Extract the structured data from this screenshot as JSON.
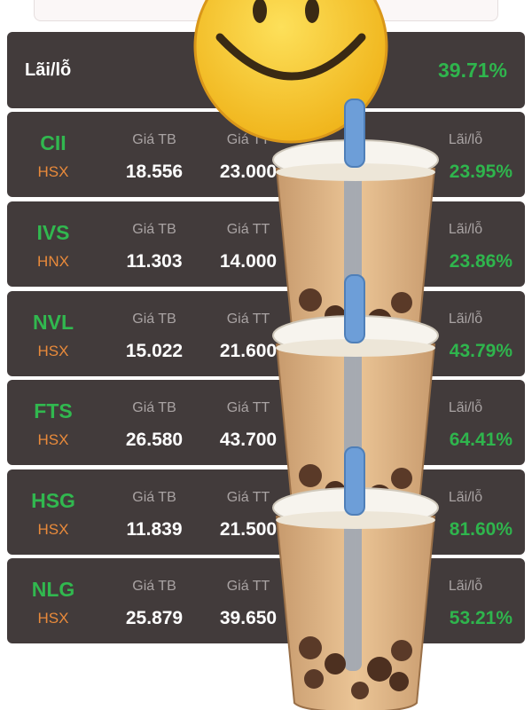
{
  "summary": {
    "label": "Lãi/lỗ",
    "value": "39.71%"
  },
  "columns": {
    "avg_price": "Giá TB",
    "market_price": "Giá TT",
    "profit_loss": "Lãi/lỗ"
  },
  "stocks": [
    {
      "ticker": "CII",
      "exchange": "HSX",
      "avg_price": "18.556",
      "market_price": "23.000",
      "pl": "23.95%"
    },
    {
      "ticker": "IVS",
      "exchange": "HNX",
      "avg_price": "11.303",
      "market_price": "14.000",
      "pl": "23.86%"
    },
    {
      "ticker": "NVL",
      "exchange": "HSX",
      "avg_price": "15.022",
      "market_price": "21.600",
      "pl": "43.79%"
    },
    {
      "ticker": "FTS",
      "exchange": "HSX",
      "avg_price": "26.580",
      "market_price": "43.700",
      "pl": "64.41%"
    },
    {
      "ticker": "HSG",
      "exchange": "HSX",
      "avg_price": "11.839",
      "market_price": "21.500",
      "pl": "81.60%"
    },
    {
      "ticker": "NLG",
      "exchange": "HSX",
      "avg_price": "25.879",
      "market_price": "39.650",
      "pl": "53.21%"
    }
  ],
  "colors": {
    "card": "#423b3b",
    "gain": "#2fb54d",
    "ticker": "#31b84f",
    "exchange": "#e98a3b",
    "muted": "#a9a3a3"
  }
}
